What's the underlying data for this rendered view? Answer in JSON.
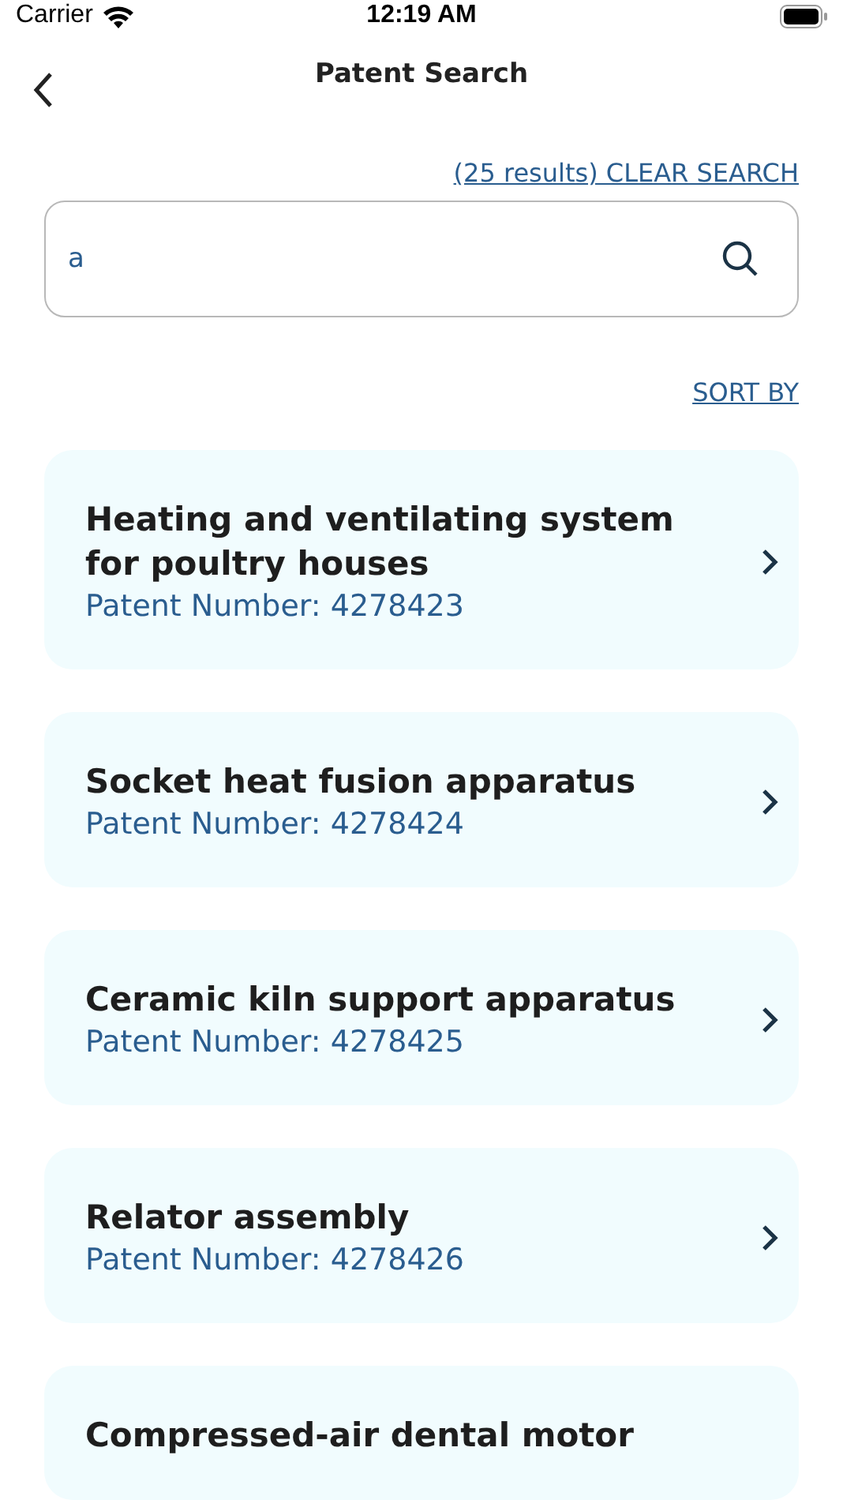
{
  "status_bar": {
    "carrier": "Carrier",
    "time": "12:19 AM"
  },
  "nav": {
    "title": "Patent Search"
  },
  "results_link": "(25 results) CLEAR SEARCH",
  "search": {
    "value": "a"
  },
  "sort_link": "SORT BY",
  "patents": [
    {
      "title": "Heating and ventilating system for poultry houses",
      "number": "Patent Number: 4278423"
    },
    {
      "title": "Socket heat fusion apparatus",
      "number": "Patent Number: 4278424"
    },
    {
      "title": "Ceramic kiln support apparatus",
      "number": "Patent Number: 4278425"
    },
    {
      "title": "Relator assembly",
      "number": "Patent Number: 4278426"
    },
    {
      "title": "Compressed-air dental motor"
    }
  ]
}
